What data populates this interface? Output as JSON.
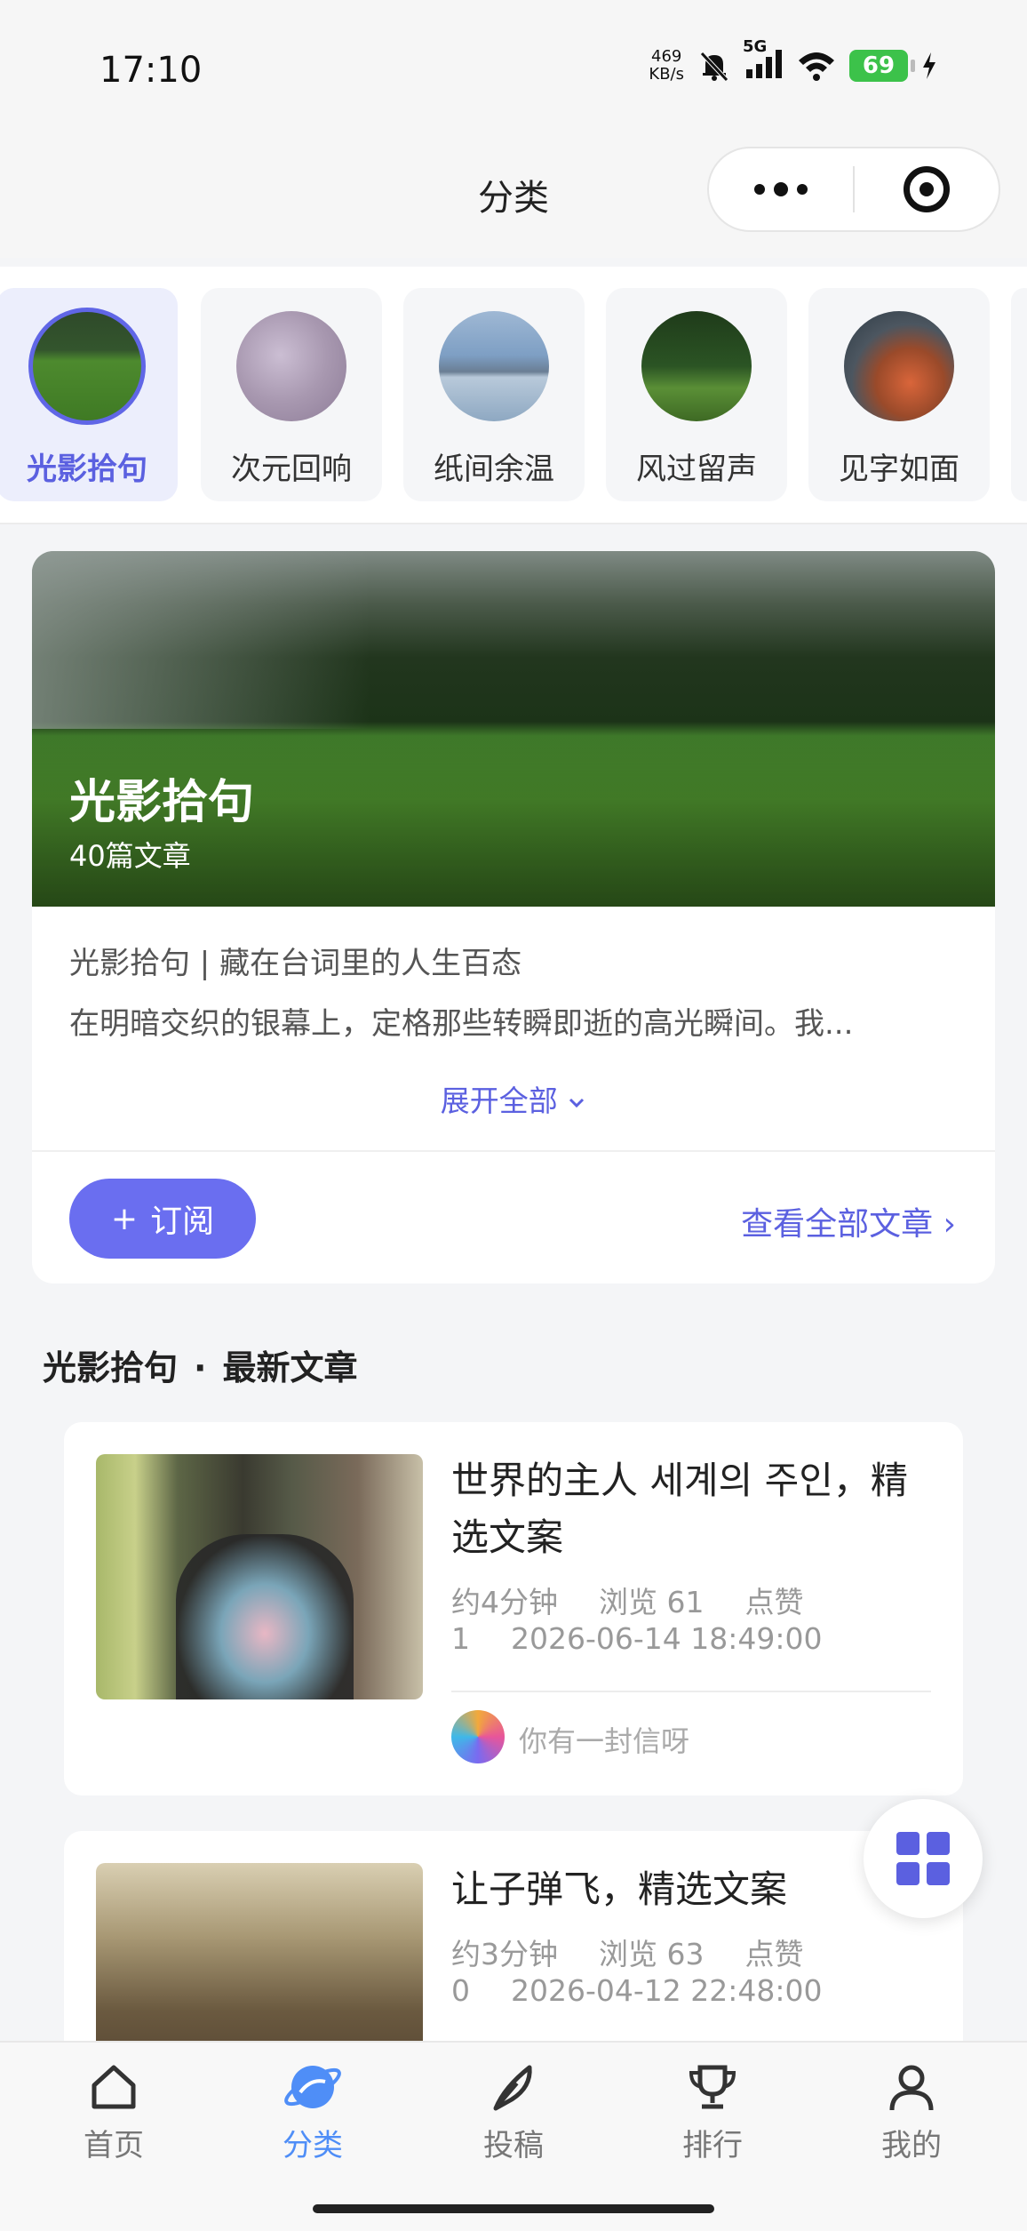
{
  "status_bar": {
    "time": "17:10",
    "net_speed_value": "469",
    "net_speed_unit": "KB/s",
    "network": "5G",
    "battery": "69"
  },
  "nav": {
    "title": "分类"
  },
  "categories": [
    {
      "label": "光影拾句",
      "active": true
    },
    {
      "label": "次元回响",
      "active": false
    },
    {
      "label": "纸间余温",
      "active": false
    },
    {
      "label": "风过留声",
      "active": false
    },
    {
      "label": "见字如面",
      "active": false
    }
  ],
  "hero": {
    "title": "光影拾句",
    "count": "40篇文章",
    "desc_line1": "光影拾句 | 藏在台词里的人生百态",
    "desc_line2": "在明暗交织的银幕上，定格那些转瞬即逝的高光瞬间。我...",
    "expand": "展开全部",
    "subscribe_icon": "+",
    "subscribe": "订阅",
    "view_all": "查看全部文章 ›"
  },
  "section": {
    "category": "光影拾句",
    "separator": "·",
    "title": "最新文章"
  },
  "articles": [
    {
      "title": "世界的主人 세계의 주인，精选文案",
      "read_time": "约4分钟",
      "views": "浏览 61",
      "likes_label": "点赞",
      "likes": "1",
      "date": "2026-06-14 18:49:00",
      "author": "你有一封信呀"
    },
    {
      "title": "让子弹飞，精选文案",
      "read_time": "约3分钟",
      "views": "浏览 63",
      "likes_label": "点赞",
      "likes": "0",
      "date": "2026-04-12 22:48:00"
    }
  ],
  "tabs": [
    {
      "label": "首页",
      "icon": "home-icon",
      "active": false
    },
    {
      "label": "分类",
      "icon": "planet-icon",
      "active": true
    },
    {
      "label": "投稿",
      "icon": "feather-icon",
      "active": false
    },
    {
      "label": "排行",
      "icon": "trophy-icon",
      "active": false
    },
    {
      "label": "我的",
      "icon": "user-icon",
      "active": false
    }
  ],
  "colors": {
    "accent": "#5b60e0",
    "tab_active": "#4f8ef7",
    "battery": "#3cc24a"
  }
}
